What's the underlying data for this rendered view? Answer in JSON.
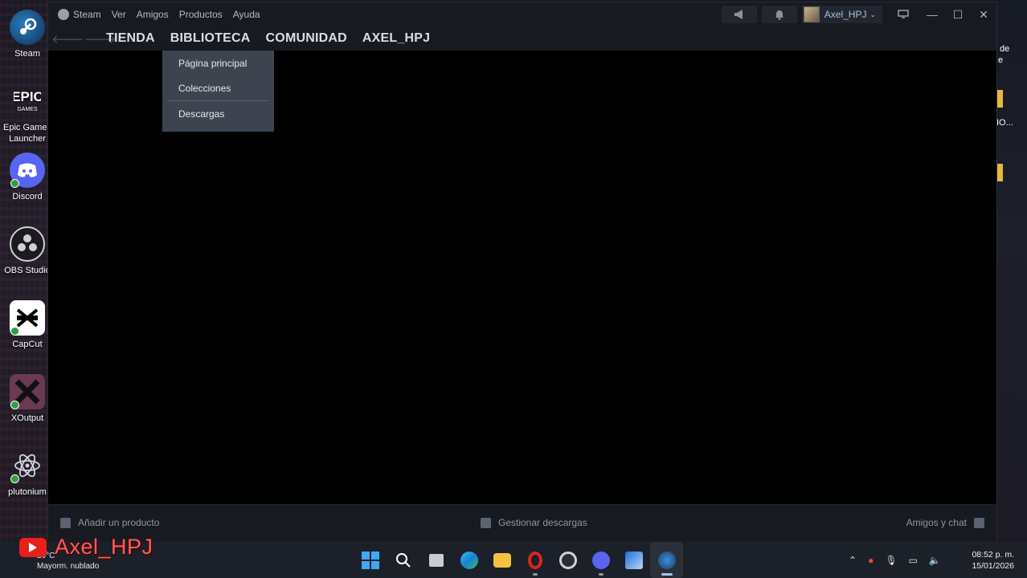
{
  "desktop": {
    "icons": [
      {
        "label": "Steam",
        "icon": "steam-icon"
      },
      {
        "label": "Epic Games Launcher",
        "icon": "epic-games-icon"
      },
      {
        "label": "Discord",
        "icon": "discord-icon"
      },
      {
        "label": "OBS Studio",
        "icon": "obs-icon"
      },
      {
        "label": "CapCut",
        "icon": "capcut-icon"
      },
      {
        "label": "XOutput",
        "icon": "xoutput-icon"
      },
      {
        "label": "plutonium",
        "icon": "plutonium-icon"
      }
    ],
    "right_peek": {
      "text1": "de",
      "text2": "e",
      "text3": "IO..."
    }
  },
  "steam": {
    "menu": [
      "Steam",
      "Ver",
      "Amigos",
      "Productos",
      "Ayuda"
    ],
    "user": {
      "name": "Axel_HPJ",
      "chevron": "chevron-down-icon"
    },
    "nav_tabs": [
      "TIENDA",
      "BIBLIOTECA",
      "COMUNIDAD",
      "AXEL_HPJ"
    ],
    "dropdown": [
      "Página principal",
      "Colecciones",
      "Descargas"
    ],
    "bottom": {
      "add_product": "Añadir un producto",
      "manage_downloads": "Gestionar descargas",
      "friends_chat": "Amigos y chat"
    }
  },
  "overlay": {
    "channel_name": "Axel_HPJ"
  },
  "taskbar": {
    "weather_temp": "20°C",
    "weather_desc": "Mayorm. nublado",
    "time": "08:52 p. m.",
    "date": "15/01/2026",
    "apps": [
      "windows-start-icon",
      "search-icon",
      "task-view-icon",
      "edge-icon",
      "file-explorer-icon",
      "opera-icon",
      "chrome-icon",
      "discord-icon",
      "rocket-league-icon",
      "steam-icon"
    ]
  },
  "colors": {
    "steam_titlebar": "#171a21",
    "dropdown_bg": "#3d4450",
    "accent_user": "#a4c3e0",
    "overlay_red": "#ff5c5c"
  }
}
